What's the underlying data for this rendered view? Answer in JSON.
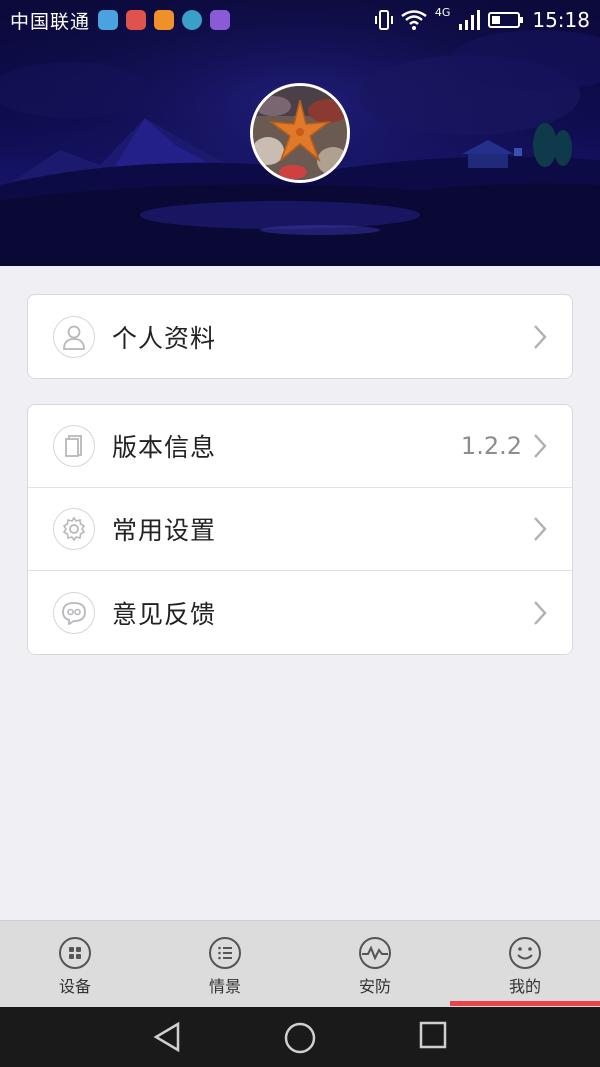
{
  "status_bar": {
    "carrier": "中国联通",
    "network": "4G",
    "time": "15:18"
  },
  "profile": {
    "avatar": "starfish-photo"
  },
  "personal": {
    "label": "个人资料"
  },
  "menu": {
    "version": {
      "label": "版本信息",
      "value": "1.2.2"
    },
    "settings": {
      "label": "常用设置"
    },
    "feedback": {
      "label": "意见反馈"
    }
  },
  "tabs": [
    {
      "label": "设备",
      "icon": "device-grid-icon"
    },
    {
      "label": "情景",
      "icon": "scene-list-icon"
    },
    {
      "label": "安防",
      "icon": "security-pulse-icon"
    },
    {
      "label": "我的",
      "icon": "smiley-icon",
      "active": true
    }
  ],
  "colors": {
    "banner": "#0e0c4e",
    "active_indicator": "#e8444c",
    "tabbar": "#dcdcdc"
  }
}
